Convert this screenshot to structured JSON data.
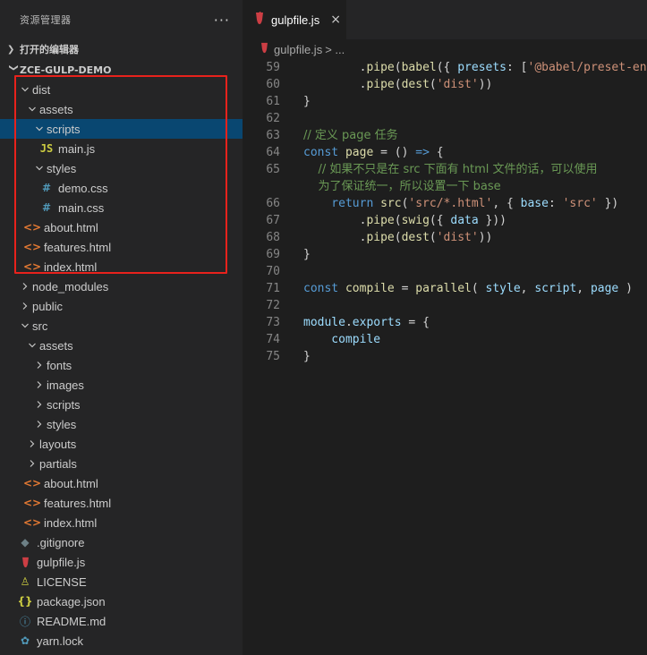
{
  "sidebar": {
    "title": "资源管理器",
    "more": "···",
    "open_editors_label": "打开的编辑器",
    "project_label": "ZCE-GULP-DEMO",
    "tree": [
      {
        "label": "dist",
        "indent": 1,
        "kind": "folder-open"
      },
      {
        "label": "assets",
        "indent": 2,
        "kind": "folder-open"
      },
      {
        "label": "scripts",
        "indent": 3,
        "kind": "folder-open",
        "selected": true
      },
      {
        "label": "main.js",
        "indent": 4,
        "kind": "js"
      },
      {
        "label": "styles",
        "indent": 3,
        "kind": "folder-open"
      },
      {
        "label": "demo.css",
        "indent": 4,
        "kind": "css"
      },
      {
        "label": "main.css",
        "indent": 4,
        "kind": "css"
      },
      {
        "label": "about.html",
        "indent": 2,
        "kind": "html"
      },
      {
        "label": "features.html",
        "indent": 2,
        "kind": "html"
      },
      {
        "label": "index.html",
        "indent": 2,
        "kind": "html"
      },
      {
        "label": "node_modules",
        "indent": 1,
        "kind": "folder-closed"
      },
      {
        "label": "public",
        "indent": 1,
        "kind": "folder-closed"
      },
      {
        "label": "src",
        "indent": 1,
        "kind": "folder-open"
      },
      {
        "label": "assets",
        "indent": 2,
        "kind": "folder-open"
      },
      {
        "label": "fonts",
        "indent": 3,
        "kind": "folder-closed"
      },
      {
        "label": "images",
        "indent": 3,
        "kind": "folder-closed"
      },
      {
        "label": "scripts",
        "indent": 3,
        "kind": "folder-closed"
      },
      {
        "label": "styles",
        "indent": 3,
        "kind": "folder-closed"
      },
      {
        "label": "layouts",
        "indent": 2,
        "kind": "folder-closed"
      },
      {
        "label": "partials",
        "indent": 2,
        "kind": "folder-closed"
      },
      {
        "label": "about.html",
        "indent": 2,
        "kind": "html"
      },
      {
        "label": "features.html",
        "indent": 2,
        "kind": "html"
      },
      {
        "label": "index.html",
        "indent": 2,
        "kind": "html"
      },
      {
        "label": ".gitignore",
        "indent": 1,
        "kind": "git"
      },
      {
        "label": "gulpfile.js",
        "indent": 1,
        "kind": "gulp"
      },
      {
        "label": "LICENSE",
        "indent": 1,
        "kind": "license"
      },
      {
        "label": "package.json",
        "indent": 1,
        "kind": "json"
      },
      {
        "label": "README.md",
        "indent": 1,
        "kind": "info"
      },
      {
        "label": "yarn.lock",
        "indent": 1,
        "kind": "yarn"
      }
    ]
  },
  "editor": {
    "tab_label": "gulpfile.js",
    "tab_close": "×",
    "breadcrumb_file": "gulpfile.js",
    "breadcrumb_rest": "> ...",
    "lines": [
      {
        "n": "59",
        "segs": [
          [
            "p",
            "        ."
          ],
          [
            "f",
            "pipe"
          ],
          [
            "p",
            "("
          ],
          [
            "f",
            "babel"
          ],
          [
            "p",
            "({ "
          ],
          [
            "v",
            "presets"
          ],
          [
            "p",
            ": ["
          ],
          [
            "s",
            "'@babel/preset-env"
          ]
        ]
      },
      {
        "n": "60",
        "segs": [
          [
            "p",
            "        ."
          ],
          [
            "f",
            "pipe"
          ],
          [
            "p",
            "("
          ],
          [
            "f",
            "dest"
          ],
          [
            "p",
            "("
          ],
          [
            "s",
            "'dist'"
          ],
          [
            "p",
            "))"
          ]
        ]
      },
      {
        "n": "61",
        "segs": [
          [
            "p",
            "}"
          ]
        ]
      },
      {
        "n": "62",
        "segs": []
      },
      {
        "n": "63",
        "segs": [
          [
            "c",
            "// 定义 page 任务"
          ]
        ]
      },
      {
        "n": "64",
        "segs": [
          [
            "k",
            "const "
          ],
          [
            "f",
            "page"
          ],
          [
            "p",
            " = () "
          ],
          [
            "k",
            "=>"
          ],
          [
            "p",
            " {"
          ]
        ]
      },
      {
        "n": "65",
        "segs": [
          [
            "c",
            "    // 如果不只是在 src 下面有 html 文件的话，可以使用"
          ]
        ]
      },
      {
        "n": "",
        "segs": [
          [
            "c",
            "    为了保证统一，所以设置一下 base"
          ]
        ]
      },
      {
        "n": "66",
        "segs": [
          [
            "k",
            "    return "
          ],
          [
            "f",
            "src"
          ],
          [
            "p",
            "("
          ],
          [
            "s",
            "'src/*.html'"
          ],
          [
            "p",
            ", { "
          ],
          [
            "v",
            "base"
          ],
          [
            "p",
            ": "
          ],
          [
            "s",
            "'src'"
          ],
          [
            "p",
            " })"
          ]
        ]
      },
      {
        "n": "67",
        "segs": [
          [
            "p",
            "        ."
          ],
          [
            "f",
            "pipe"
          ],
          [
            "p",
            "("
          ],
          [
            "f",
            "swig"
          ],
          [
            "p",
            "({ "
          ],
          [
            "v",
            "data"
          ],
          [
            "p",
            " }))"
          ]
        ]
      },
      {
        "n": "68",
        "segs": [
          [
            "p",
            "        ."
          ],
          [
            "f",
            "pipe"
          ],
          [
            "p",
            "("
          ],
          [
            "f",
            "dest"
          ],
          [
            "p",
            "("
          ],
          [
            "s",
            "'dist'"
          ],
          [
            "p",
            "))"
          ]
        ]
      },
      {
        "n": "69",
        "segs": [
          [
            "p",
            "}"
          ]
        ]
      },
      {
        "n": "70",
        "segs": []
      },
      {
        "n": "71",
        "segs": [
          [
            "k",
            "const "
          ],
          [
            "f",
            "compile"
          ],
          [
            "p",
            " = "
          ],
          [
            "f",
            "parallel"
          ],
          [
            "p",
            "( "
          ],
          [
            "v",
            "style"
          ],
          [
            "p",
            ", "
          ],
          [
            "v",
            "script"
          ],
          [
            "p",
            ", "
          ],
          [
            "v",
            "page"
          ],
          [
            "p",
            " )"
          ]
        ]
      },
      {
        "n": "72",
        "segs": []
      },
      {
        "n": "73",
        "segs": [
          [
            "v",
            "module"
          ],
          [
            "p",
            "."
          ],
          [
            "v",
            "exports"
          ],
          [
            "p",
            " = {"
          ]
        ]
      },
      {
        "n": "74",
        "segs": [
          [
            "v",
            "    compile"
          ]
        ]
      },
      {
        "n": "75",
        "segs": [
          [
            "p",
            "}"
          ]
        ]
      }
    ]
  },
  "icons": {
    "more": "ellipsis-icon",
    "chevron": "chevron-icon",
    "gulp": "gulp-icon",
    "close": "close-icon"
  },
  "colors": {
    "sidebar_bg": "#252526",
    "editor_bg": "#1e1e1e",
    "selection": "#094771",
    "highlight_border": "#e8221c"
  }
}
